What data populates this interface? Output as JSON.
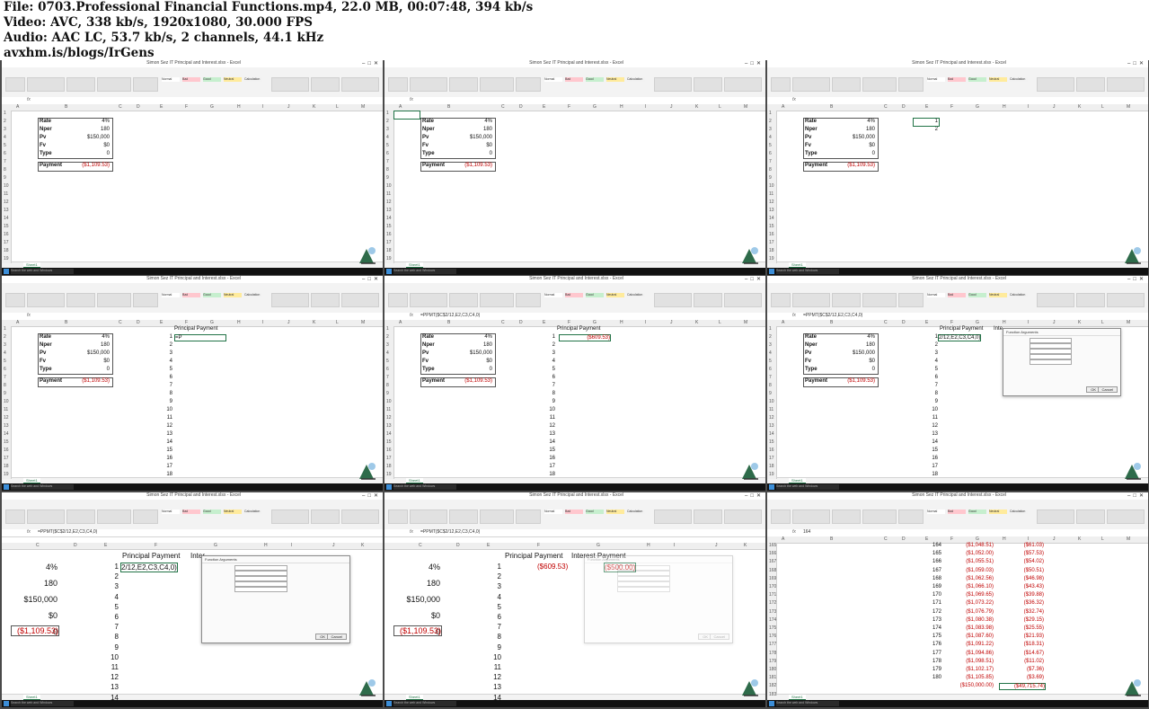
{
  "header": {
    "line1": "File: 0703.Professional Financial Functions.mp4, 22.0 MB, 00:07:48, 394 kb/s",
    "line2": "Video: AVC, 338 kb/s, 1920x1080, 30.000 FPS",
    "line3": "Audio: AAC LC, 53.7 kb/s, 2 channels, 44.1 kHz",
    "line4": "avxhm.is/blogs/IrGens"
  },
  "excel": {
    "window_title": "Simon Sez IT Principal and Interest.xlsx - Excel",
    "tabs": [
      "File",
      "Home",
      "Insert",
      "Page Layout",
      "Formulas",
      "Data",
      "Review",
      "View"
    ],
    "tell_me": "Tell me what you want to do",
    "sheet_tab": "Sheet1",
    "search_placeholder": "Search the web and Windows",
    "styles": [
      "Normal",
      "Bad",
      "Good",
      "Neutral",
      "Calculation"
    ],
    "columns": [
      "A",
      "B",
      "C",
      "D",
      "E",
      "F",
      "G",
      "H",
      "I",
      "J",
      "K",
      "L",
      "M"
    ],
    "labels": {
      "rate": "Rate",
      "nper": "Nper",
      "pv": "Pv",
      "fv": "Fv",
      "type": "Type",
      "payment": "Payment"
    },
    "values": {
      "rate": "4%",
      "nper": "180",
      "pv": "$150,000",
      "fv": "$0",
      "type": "0",
      "payment": "($1,109.53)"
    },
    "principal_header": "Principal Payment",
    "interest_header": "Interest Payment",
    "principal_first": "($609.53)",
    "interest_first": "($500.00)",
    "formula_ppmt": "=PPMT($C$2/12,E2,C3,C4,0)",
    "formula_partial": "2/12,E2,C3,C4,0)",
    "typing": "=P",
    "dialog_title": "Function Arguments",
    "dialog_ok": "OK",
    "dialog_cancel": "Cancel",
    "e_col_vals": [
      "1",
      "2"
    ]
  },
  "zoom_frame": {
    "values": [
      "4%",
      "180",
      "$150,000",
      "$0",
      "0",
      "($1,109.53)"
    ],
    "row_numbers": [
      "1",
      "2",
      "3",
      "4",
      "5",
      "6",
      "7",
      "8",
      "9",
      "10",
      "11",
      "12",
      "13",
      "14"
    ]
  },
  "tail_frame": {
    "rows": [
      {
        "r": "165",
        "n": "164",
        "p": "($1,048.51)",
        "i": "($61.03)"
      },
      {
        "r": "166",
        "n": "165",
        "p": "($1,052.00)",
        "i": "($57.53)"
      },
      {
        "r": "167",
        "n": "166",
        "p": "($1,055.51)",
        "i": "($54.02)"
      },
      {
        "r": "168",
        "n": "167",
        "p": "($1,059.03)",
        "i": "($50.51)"
      },
      {
        "r": "169",
        "n": "168",
        "p": "($1,062.56)",
        "i": "($46.98)"
      },
      {
        "r": "170",
        "n": "169",
        "p": "($1,066.10)",
        "i": "($43.43)"
      },
      {
        "r": "171",
        "n": "170",
        "p": "($1,069.65)",
        "i": "($39.88)"
      },
      {
        "r": "172",
        "n": "171",
        "p": "($1,073.22)",
        "i": "($36.32)"
      },
      {
        "r": "173",
        "n": "172",
        "p": "($1,076.79)",
        "i": "($32.74)"
      },
      {
        "r": "174",
        "n": "173",
        "p": "($1,080.38)",
        "i": "($29.15)"
      },
      {
        "r": "175",
        "n": "174",
        "p": "($1,083.98)",
        "i": "($25.55)"
      },
      {
        "r": "176",
        "n": "175",
        "p": "($1,087.60)",
        "i": "($21.93)"
      },
      {
        "r": "177",
        "n": "176",
        "p": "($1,091.22)",
        "i": "($18.31)"
      },
      {
        "r": "178",
        "n": "177",
        "p": "($1,094.86)",
        "i": "($14.67)"
      },
      {
        "r": "179",
        "n": "178",
        "p": "($1,098.51)",
        "i": "($11.02)"
      },
      {
        "r": "180",
        "n": "179",
        "p": "($1,102.17)",
        "i": "($7.36)"
      },
      {
        "r": "181",
        "n": "180",
        "p": "($1,105.85)",
        "i": "($3.69)"
      }
    ],
    "total_p": "($150,000.00)",
    "total_i": "($49,715.74)",
    "row_total": "182",
    "row_after": "183",
    "first_row": "164"
  }
}
